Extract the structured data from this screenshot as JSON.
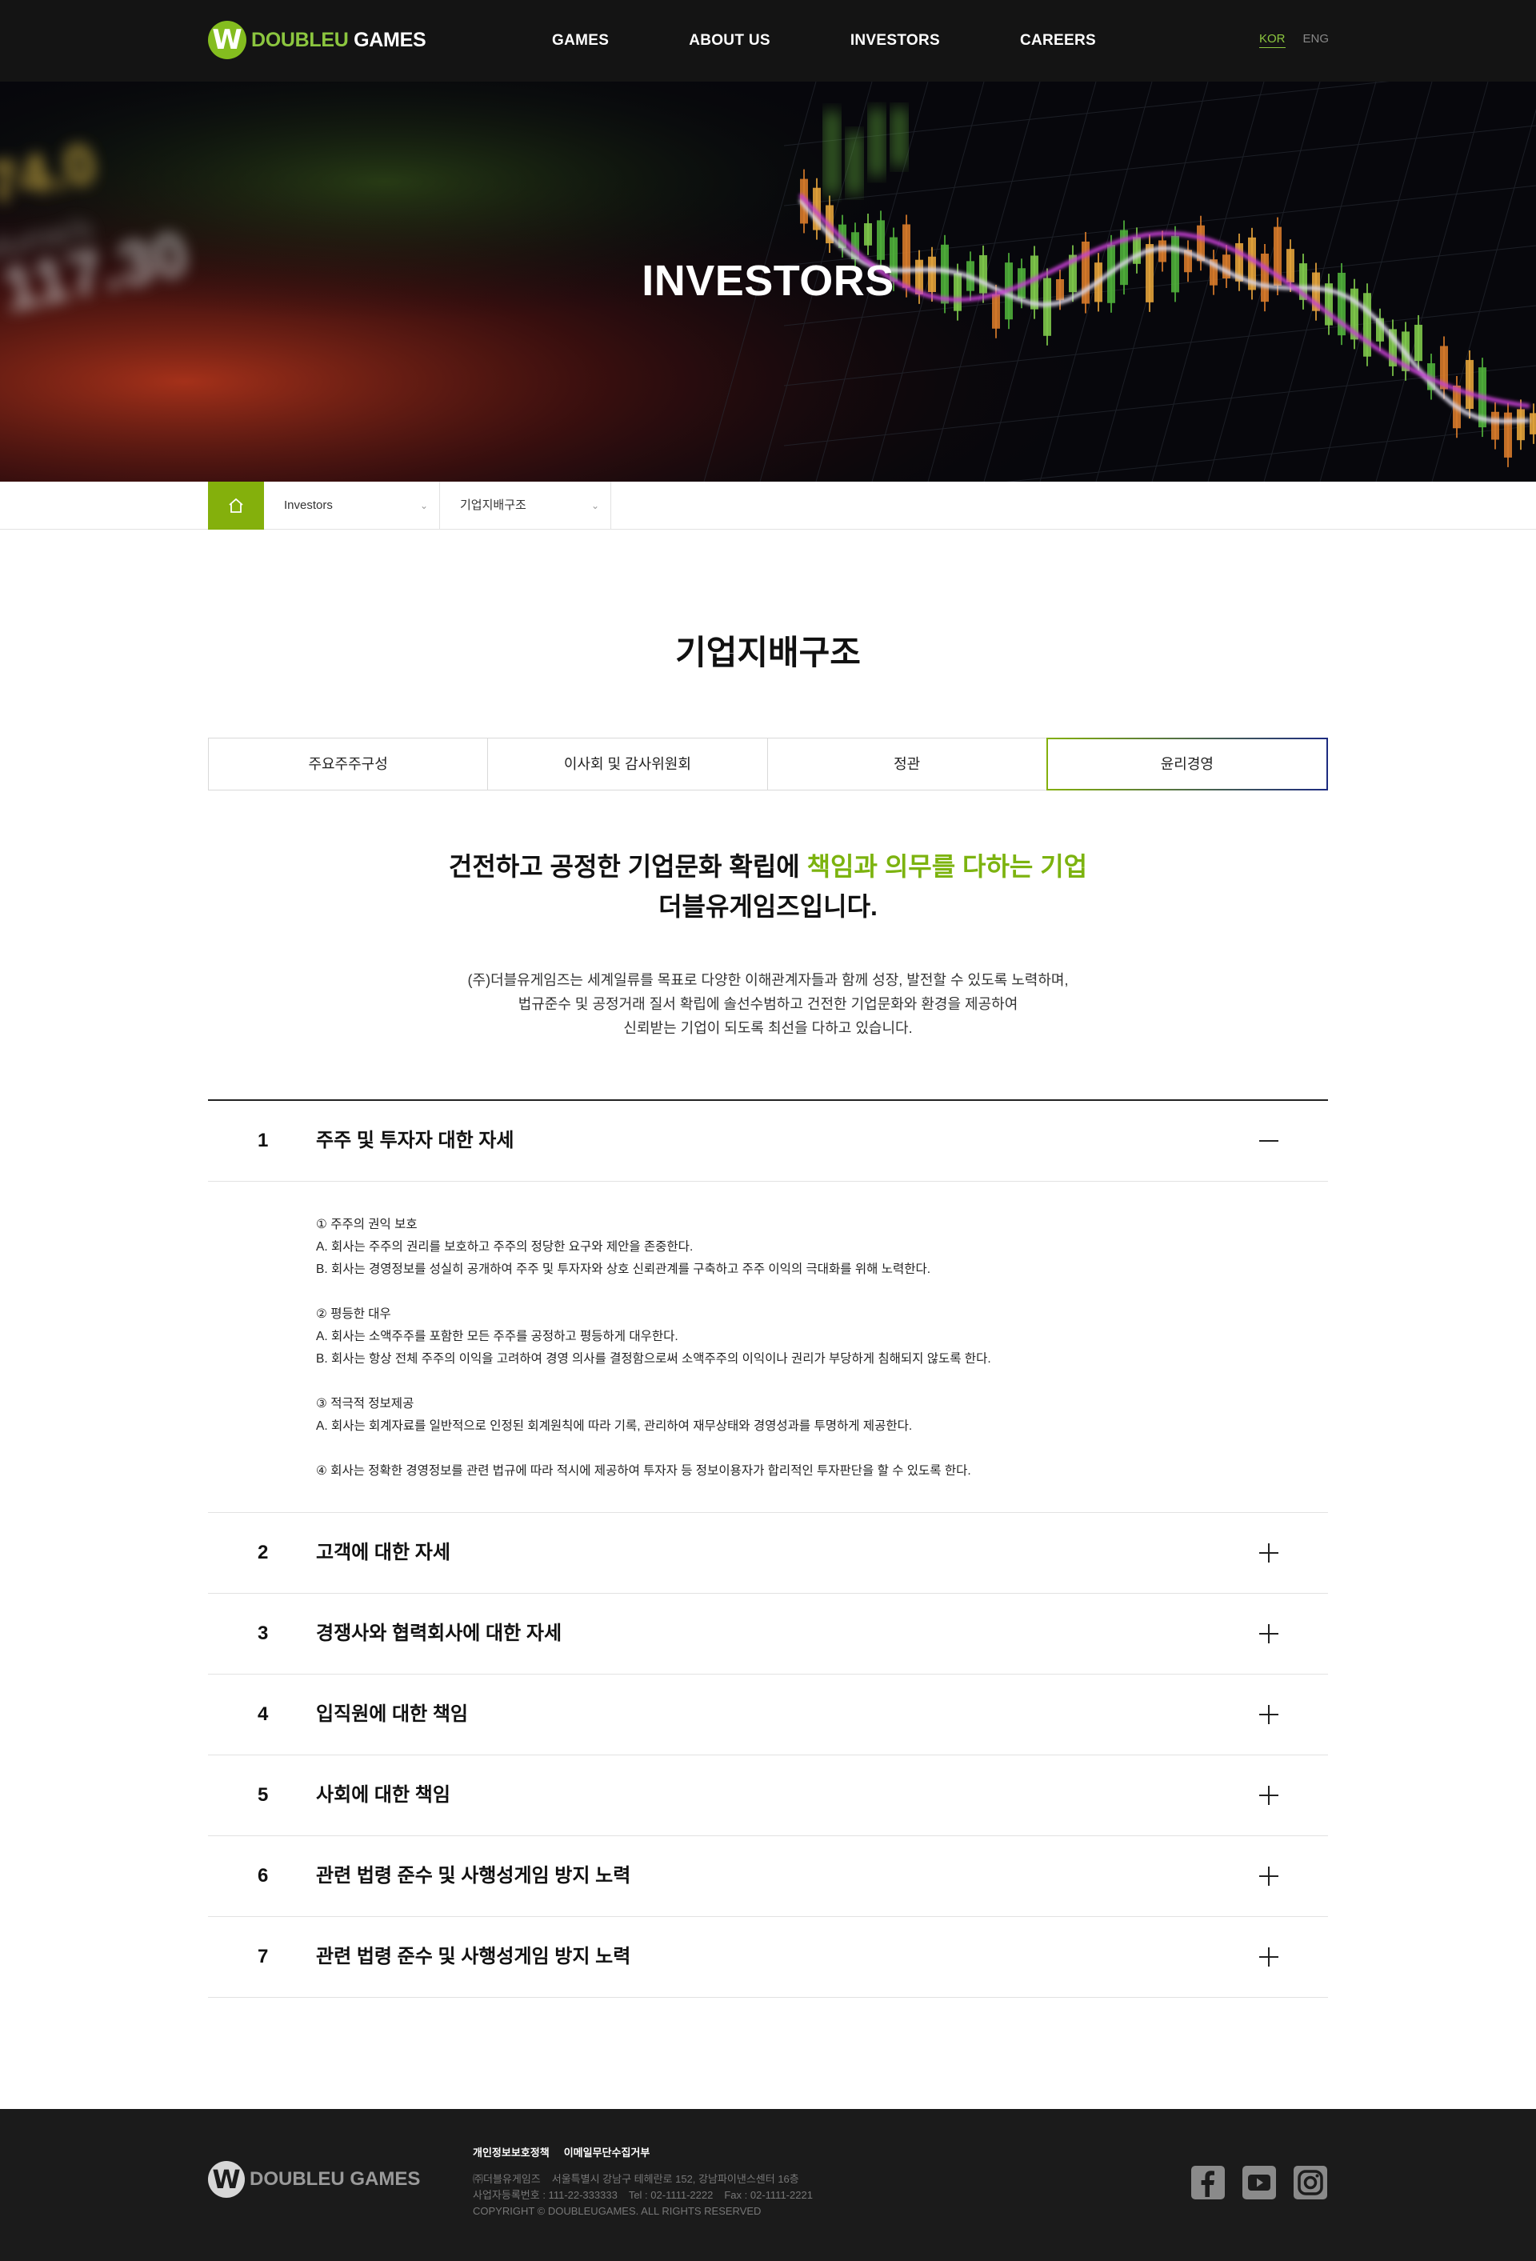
{
  "header": {
    "logo_text_1": "DOUBLEU",
    "logo_text_2": " GAMES",
    "nav": [
      "GAMES",
      "ABOUT US",
      "INVESTORS",
      "CAREERS"
    ],
    "lang_kor": "KOR",
    "lang_eng": "ENG"
  },
  "hero": {
    "title": "INVESTORS"
  },
  "breadcrumb": {
    "level1": "Investors",
    "level2": "기업지배구조"
  },
  "page": {
    "title": "기업지배구조"
  },
  "tabs": [
    "주요주주구성",
    "이사회 및 감사위원회",
    "정관",
    "윤리경영"
  ],
  "intro": {
    "head_1": "건전하고 공정한 기업문화 확립에 ",
    "head_accent": "책임과 의무를 다하는 기업",
    "head_2": "더블유게임즈입니다.",
    "body_1": "(주)더블유게임즈는 세계일류를 목표로 다양한 이해관계자들과 함께 성장, 발전할 수 있도록 노력하며,",
    "body_2": "법규준수 및 공정거래 질서 확립에 솔선수범하고 건전한 기업문화와 환경을 제공하여",
    "body_3": "신뢰받는 기업이 되도록 최선을 다하고 있습니다."
  },
  "accordion": [
    {
      "num": "1",
      "title": "주주 및 투자자 대한 자세",
      "expanded": true
    },
    {
      "num": "2",
      "title": "고객에 대한 자세",
      "expanded": false
    },
    {
      "num": "3",
      "title": "경쟁사와 협력회사에 대한 자세",
      "expanded": false
    },
    {
      "num": "4",
      "title": "입직원에 대한 책임",
      "expanded": false
    },
    {
      "num": "5",
      "title": "사회에 대한 책임",
      "expanded": false
    },
    {
      "num": "6",
      "title": "관련 법령 준수 및 사행성게임 방지 노력",
      "expanded": false
    },
    {
      "num": "7",
      "title": "관련 법령 준수 및 사행성게임 방지 노력",
      "expanded": false
    }
  ],
  "accordion_body": {
    "s1_title": "① 주주의 권익 보호",
    "s1_a": "A. 회사는 주주의 권리를 보호하고 주주의 정당한 요구와 제안을 존중한다.",
    "s1_b": "B. 회사는 경영정보를 성실히 공개하여 주주 및 투자자와 상호 신뢰관계를 구축하고 주주 이익의 극대화를 위해 노력한다.",
    "s2_title": "② 평등한 대우",
    "s2_a": "A. 회사는 소액주주를 포함한 모든 주주를 공정하고 평등하게 대우한다.",
    "s2_b": "B. 회사는 항상 전체 주주의 이익을 고려하여 경영 의사를 결정함으로써 소액주주의 이익이나 권리가 부당하게 침해되지 않도록 한다.",
    "s3_title": "③ 적극적 정보제공",
    "s3_a": "A. 회사는 회계자료를 일반적으로 인정된 회계원칙에 따라 기록, 관리하여 재무상태와 경영성과를 투명하게 제공한다.",
    "s4": "④ 회사는 정확한 경영정보를 관련 법규에 따라 적시에 제공하여 투자자 등 정보이용자가 합리적인 투자판단을 할 수 있도록 한다."
  },
  "footer": {
    "logo_text": "DOUBLEU GAMES",
    "link_privacy": "개인정보보호정책",
    "link_email": "이메일무단수집거부",
    "company": "㈜더블유게임즈",
    "address": "서울특별시 강남구 테헤란로 152, 강남파이낸스센터 16층",
    "biz_no": "사업자등록번호 : 111-22-333333",
    "tel": "Tel : 02-1111-2222",
    "fax": "Fax : 02-1111-2221",
    "copyright": "COPYRIGHT © DOUBLEUGAMES. ALL RIGHTS RESERVED"
  },
  "colors": {
    "brand_green": "#84b00c",
    "accent_text": "#7cb30f",
    "header_bg": "#141414",
    "footer_bg": "#1b1b1b"
  },
  "icons": [
    "home-icon",
    "chevron-down-icon",
    "minus-icon",
    "plus-icon",
    "facebook-icon",
    "youtube-icon",
    "instagram-icon"
  ]
}
